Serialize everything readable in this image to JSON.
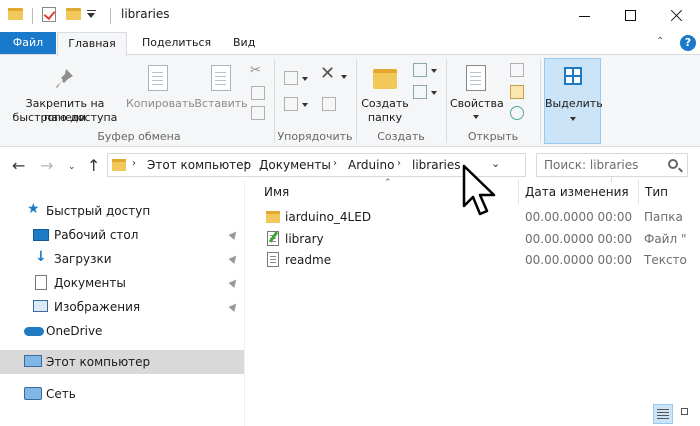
{
  "window": {
    "title": "libraries"
  },
  "ribbon_tabs": {
    "file": "Файл",
    "home": "Главная",
    "share": "Поделиться",
    "view": "Вид"
  },
  "ribbon": {
    "pin_label_1": "Закрепить на панели",
    "pin_label_2": "быстрого доступа",
    "copy": "Копировать",
    "paste": "Вставить",
    "clipboard_group": "Буфер обмена",
    "organize_group": "Упорядочить",
    "new_folder_1": "Создать",
    "new_folder_2": "папку",
    "new_group": "Создать",
    "properties": "Свойства",
    "open_group": "Открыть",
    "select": "Выделить"
  },
  "address": {
    "crumbs": [
      "Этот компьютер",
      "Документы",
      "Arduino",
      "libraries"
    ],
    "search_placeholder": "Поиск: libraries"
  },
  "nav_pane": {
    "quick_access": "Быстрый доступ",
    "desktop": "Рабочий стол",
    "downloads": "Загрузки",
    "documents": "Документы",
    "pictures": "Изображения",
    "onedrive": "OneDrive",
    "this_pc": "Этот компьютер",
    "network": "Сеть"
  },
  "columns": {
    "name": "Имя",
    "date": "Дата изменения",
    "type": "Тип"
  },
  "files": [
    {
      "name": "iarduino_4LED",
      "date": "00.00.0000 00:00",
      "type": "Папка",
      "icon": "folder-icon"
    },
    {
      "name": "library",
      "date": "00.00.0000 00:00",
      "type": "Файл \"",
      "icon": "properties-file-icon"
    },
    {
      "name": "readme",
      "date": "00.00.0000 00:00",
      "type": "Тексто",
      "icon": "text-file-icon"
    }
  ],
  "colors": {
    "accent": "#1979ca",
    "folder": "#f3c85a",
    "selected": "#cce4f7"
  }
}
